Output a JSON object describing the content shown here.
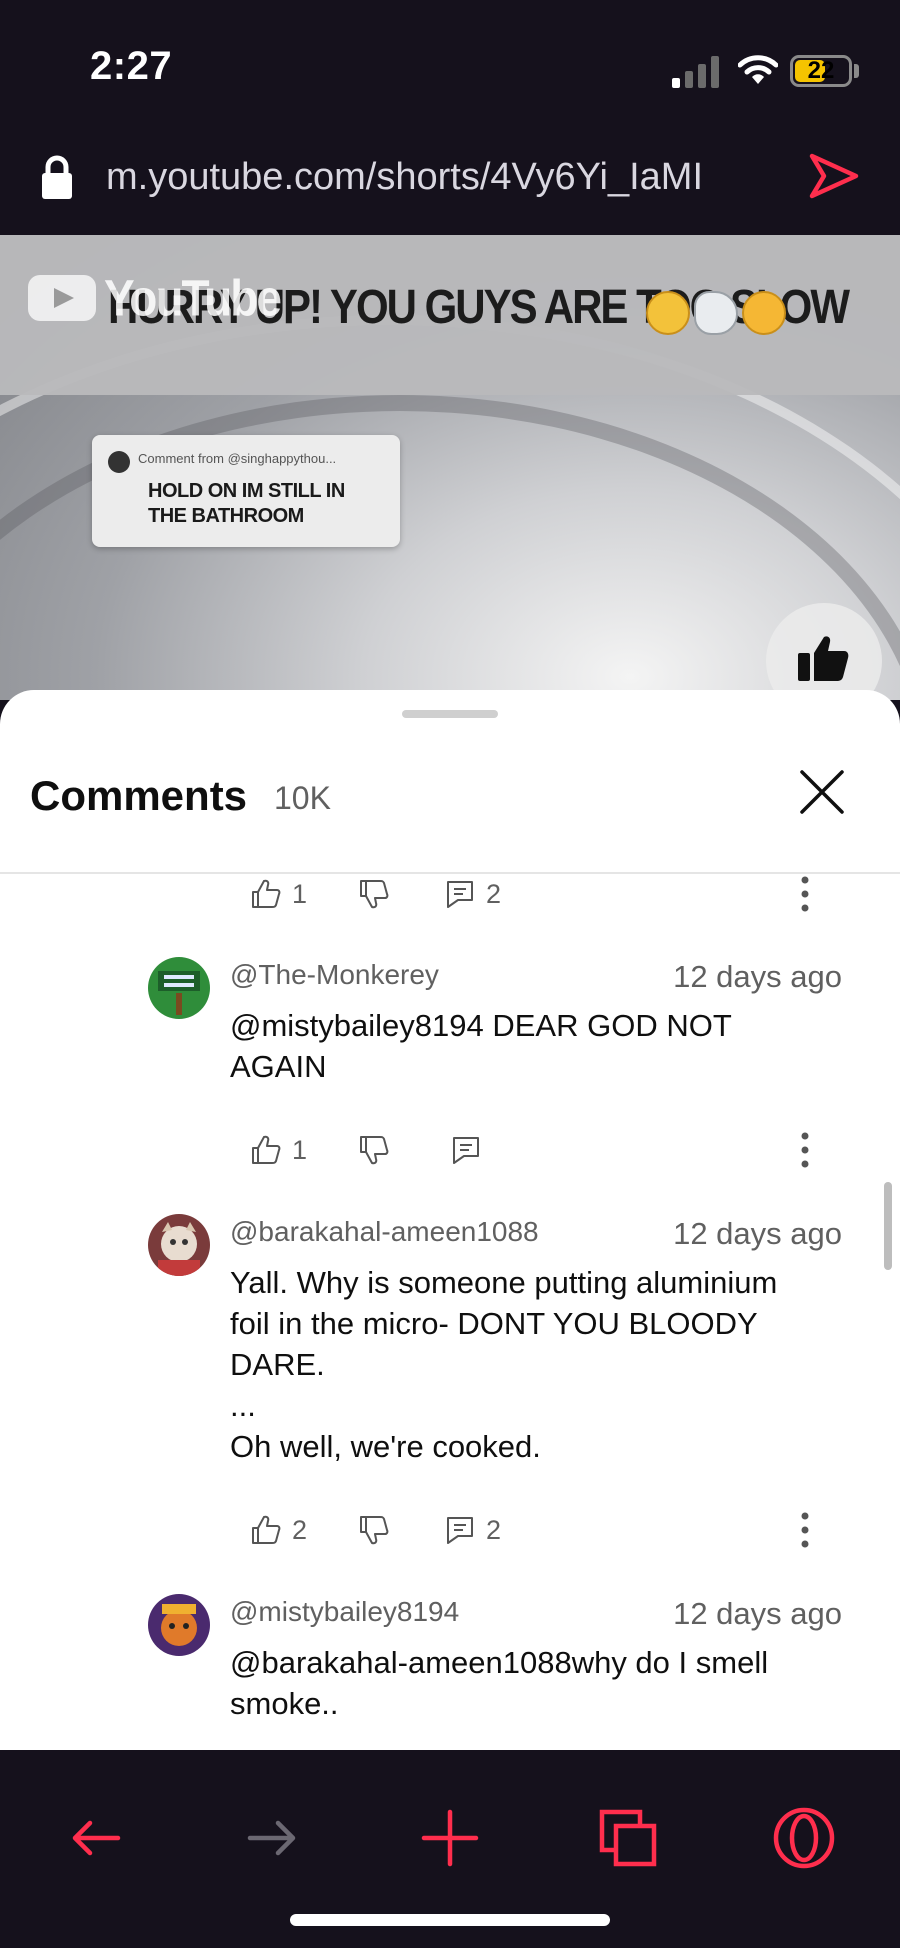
{
  "status_bar": {
    "time": "2:27",
    "battery": "22"
  },
  "address_bar": {
    "url": "m.youtube.com/shorts/4Vy6Yi_IaMI"
  },
  "video": {
    "logo_text": "YouTube",
    "caption": "HURRY UP! YOU GUYS ARE TOO SLOW",
    "overlay_from": "Comment from @singhappythou...",
    "overlay_text": "HOLD ON IM STILL IN\nTHE BATHROOM"
  },
  "comments_sheet": {
    "title": "Comments",
    "count": "10K",
    "partial_row": {
      "likes": "1",
      "replies": "2"
    },
    "comments": [
      {
        "author": "@The-Monkerey",
        "date": "12 days ago",
        "text": "@mistybailey8194 DEAR GOD NOT\nAGAIN",
        "likes": "1",
        "replies": ""
      },
      {
        "author": "@barakahal-ameen1088",
        "date": "12 days ago",
        "text": "Yall. Why is someone putting aluminium\nfoil in the micro- DONT YOU BLOODY\nDARE.\n...\nOh well, we're cooked.",
        "likes": "2",
        "replies": "2"
      },
      {
        "author": "@mistybailey8194",
        "date": "12 days ago",
        "text": "@barakahal-ameen1088why do I smell\nsmoke..",
        "likes": "",
        "replies": ""
      }
    ]
  },
  "colors": {
    "accent": "#ff2e4d",
    "dark_bg": "#15111c",
    "disabled": "#6b6872"
  },
  "toolbar": {
    "icons": [
      "back-arrow-icon",
      "forward-arrow-icon",
      "plus-icon",
      "tabs-icon",
      "opera-icon"
    ]
  }
}
